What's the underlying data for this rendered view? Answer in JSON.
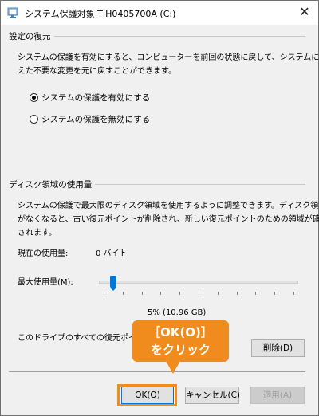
{
  "window": {
    "title": "システム保護対象 TIH0405700A (C:)",
    "close_glyph": "✕"
  },
  "restore": {
    "title": "設定の復元",
    "description_line1": "システムの保護を有効にすると、コンピューターを前回の状態に戻して、システムに加",
    "description_line2": "えた不要な変更を元に戻すことができます。",
    "options": [
      {
        "label": "システムの保護を有効にする",
        "checked": true
      },
      {
        "label": "システムの保護を無効にする",
        "checked": false
      }
    ]
  },
  "disk": {
    "title": "ディスク領域の使用量",
    "description_line1": "システムの保護で最大限のディスク領域を使用するように調整できます。ディスク領域",
    "description_line2": "がなくなると、古い復元ポイントが削除され、新しい復元ポイントのための領域が確保",
    "description_line3": "されます。",
    "current_usage_label": "現在の使用量:",
    "current_usage_value": "0 バイト",
    "max_usage_label": "最大使用量(M):",
    "max_usage_fraction": 0.05,
    "max_usage_value": "5% (10.96 GB)",
    "delete_text": "このドライブのすべての復元ポイント",
    "delete_button": "削除(D)"
  },
  "buttons": {
    "ok": "OK(O)",
    "cancel": "キャンセル(C)",
    "apply": "適用(A)"
  },
  "callout": {
    "line1": "［OK(O)］",
    "line2": "をクリック"
  },
  "colors": {
    "accent": "#0078d7",
    "callout": "#f08c1e"
  }
}
